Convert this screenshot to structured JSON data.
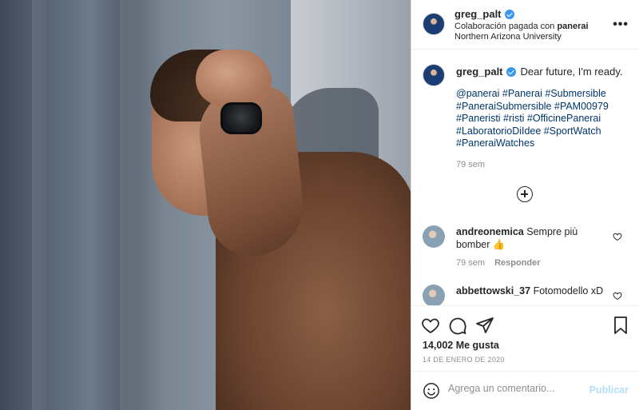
{
  "post": {
    "username": "greg_palt",
    "verified": true,
    "sponsor_prefix": "Colaboración pagada con",
    "sponsor_name": "panerai",
    "location": "Northern Arizona University",
    "more_icon": "more-dots-icon"
  },
  "caption": {
    "username": "greg_palt",
    "text": "Dear future, I'm ready.",
    "tags_lines": [
      "@panerai #Panerai #Submersible",
      "#PaneraiSubmersible #PAM00979",
      "#Paneristi #risti #OfficinePanerai",
      "#LaboratorioDiIdee #SportWatch",
      "#PaneraiWatches"
    ],
    "time": "79 sem"
  },
  "load_more_icon": "plus-circle-icon",
  "comments": [
    {
      "username": "andreonemica",
      "text": "Sempre più bomber 👍",
      "time": "79 sem",
      "reply_label": "Responder"
    },
    {
      "username": "abbettowski_37",
      "text": "Fotomodello xD"
    }
  ],
  "actions": {
    "likes": "14,002 Me gusta",
    "date": "14 DE ENERO DE 2020"
  },
  "add_comment": {
    "placeholder": "Agrega un comentario...",
    "post_label": "Publicar"
  },
  "colors": {
    "link": "#00376b",
    "verified": "#3897f0",
    "publish_disabled": "#b2dffc"
  }
}
